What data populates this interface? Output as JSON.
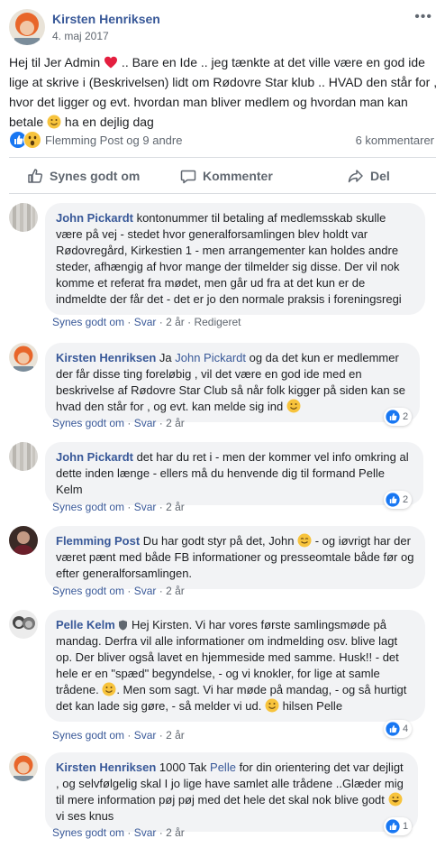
{
  "post": {
    "author": "Kirsten Henriksen",
    "date": "4. maj 2017",
    "more": "•••",
    "text_1": "Hej til Jer Admin ",
    "text_2": " .. Bare en Ide .. jeg tænkte at det ville være en god ide lige at skrive i (Beskrivelsen) lidt om Rødovre Star klub .. HVAD den står for , hvor det ligger og evt. hvordan man bliver medlem og hvordan man kan betale ",
    "text_3": " ha en dejlig dag",
    "reactions_text": "Flemming Post og 9 andre",
    "comments_count": "6 kommentarer"
  },
  "actions": {
    "like": "Synes godt om",
    "comment": "Kommenter",
    "share": "Del"
  },
  "meta_labels": {
    "like": "Synes godt om",
    "reply": "Svar",
    "sep": " · "
  },
  "comments": [
    {
      "author": "John Pickardt",
      "text": " kontonummer til betaling af medlemsskab skulle være på vej - stedet hvor generalforsamlingen blev holdt var Rødovregård, Kirkestien 1 - men arrangementer kan holdes andre steder, afhængig af hvor mange der tilmelder sig disse. Der vil nok komme et referat fra mødet, men går ud fra at det kun er de indmeldte der får det - det er jo den normale praksis i foreningsregi",
      "time": "2 år",
      "edited": "Redigeret"
    },
    {
      "author": "Kirsten Henriksen",
      "pre": " Ja ",
      "mention": "John Pickardt",
      "text": " og da det kun er medlemmer der får disse ting foreløbig , vil det være en god ide med en beskrivelse af Rødovre Star Club så når folk kigger på siden kan se hvad den står for , og evt. kan melde sig ind ",
      "time": "2 år",
      "likes": "2"
    },
    {
      "author": "John Pickardt",
      "text": " det har du ret i - men der kommer vel info omkring al dette inden længe - ellers må du henvende dig til formand Pelle Kelm",
      "time": "2 år",
      "likes": "2"
    },
    {
      "author": "Flemming Post",
      "text_1": " Du har godt styr på det, John ",
      "text_2": " - og iøvrigt har der været pænt med både FB informationer og presseomtale både før og efter generalforsamlingen.",
      "time": "2 år"
    },
    {
      "author": "Pelle Kelm",
      "text_1": " Hej Kirsten. Vi har vores første samlingsmøde på mandag. Derfra vil alle informationer om indmelding osv. blive lagt op. Der bliver også lavet en hjemmeside med samme. Husk!! - det hele er en \"spæd\" begyndelse, - og vi knokler, for lige at samle trådene. ",
      "text_2": ". Men som sagt. Vi har møde på mandag, - og så hurtigt det kan lade sig gøre, - så melder vi ud. ",
      "text_3": " hilsen Pelle",
      "time": "2 år",
      "likes": "4"
    },
    {
      "author": "Kirsten Henriksen",
      "pre": " 1000 Tak ",
      "mention": "Pelle",
      "text_1": " for din orientering det var dejligt , og selvfølgelig skal I jo lige have samlet alle trådene ..Glæder mig til mere information pøj pøj med det hele det skal nok blive godt ",
      "text_2": " vi ses knus",
      "time": "2 år",
      "likes": "1"
    }
  ],
  "colors": {
    "link": "#385898",
    "secondary": "#606770",
    "bubble": "#f2f3f5",
    "like_blue": "#1877f2",
    "heart": "#e41e3f"
  }
}
